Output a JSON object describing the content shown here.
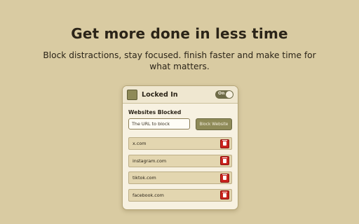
{
  "hero": {
    "headline": "Get more done in less time",
    "subline": "Block distractions, stay focused. finish faster and make time for what matters."
  },
  "popup": {
    "title": "Locked In",
    "toggle_label": "On",
    "section_title": "Websites Blocked",
    "input_placeholder": "The URL to block",
    "block_button": "Block Website",
    "sites": [
      {
        "name": "x.com"
      },
      {
        "name": "instagram.com"
      },
      {
        "name": "tiktok.com"
      },
      {
        "name": "facebook.com"
      }
    ]
  },
  "colors": {
    "background": "#d9cba2",
    "accent": "#8e8a58",
    "delete": "#c9221c"
  },
  "icons": {
    "logo": "app-logo-icon",
    "delete": "trash-icon"
  }
}
